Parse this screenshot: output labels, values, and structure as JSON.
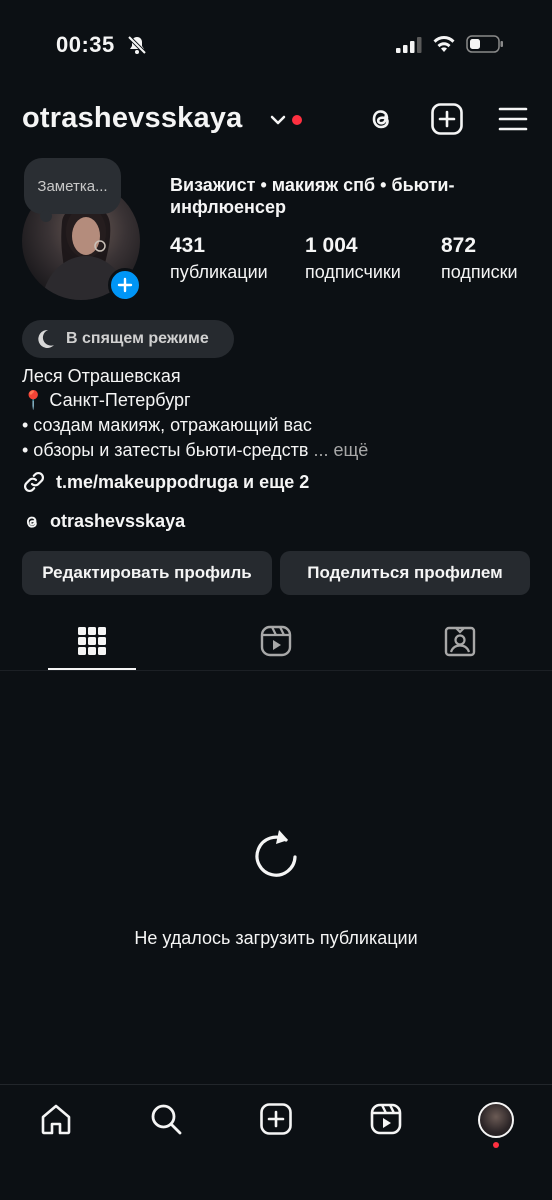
{
  "status_bar": {
    "time": "00:35",
    "icons": [
      "bell-off-icon",
      "signal-icon",
      "wifi-icon",
      "battery-icon"
    ]
  },
  "header": {
    "username": "otrashevsskaya",
    "icons": [
      "chevron-down-icon",
      "threads-icon",
      "create-icon",
      "menu-icon"
    ]
  },
  "profile": {
    "note_placeholder": "Заметка...",
    "headline": "Визажист • макияж спб • бьюти-инфлюенсер",
    "stats": [
      {
        "value": "431",
        "label": "публикации"
      },
      {
        "value": "1 004",
        "label": "подписчики"
      },
      {
        "value": "872",
        "label": "подписки"
      }
    ],
    "sleep_badge": "В спящем режиме",
    "name": "Леся Отрашевская",
    "bio_lines": [
      "📍 Санкт-Петербург",
      "• создам макияж, отражающий вас",
      "• обзоры и затесты бьюти-средств"
    ],
    "more": "... ещё",
    "link": "t.me/makeuppodruga и еще 2",
    "threads_handle": "otrashevsskaya",
    "edit_button": "Редактировать профиль",
    "share_button": "Поделиться профилем"
  },
  "tabs": [
    "grid-icon",
    "reels-icon",
    "tagged-icon"
  ],
  "content": {
    "error_message": "Не удалось загрузить публикации"
  },
  "bottom_nav": [
    "home-icon",
    "search-icon",
    "create-icon",
    "reels-icon",
    "profile-avatar"
  ],
  "colors": {
    "background": "#0c1014",
    "button": "#262a2f",
    "accent_blue": "#0095f6",
    "notification_red": "#ff3040"
  }
}
